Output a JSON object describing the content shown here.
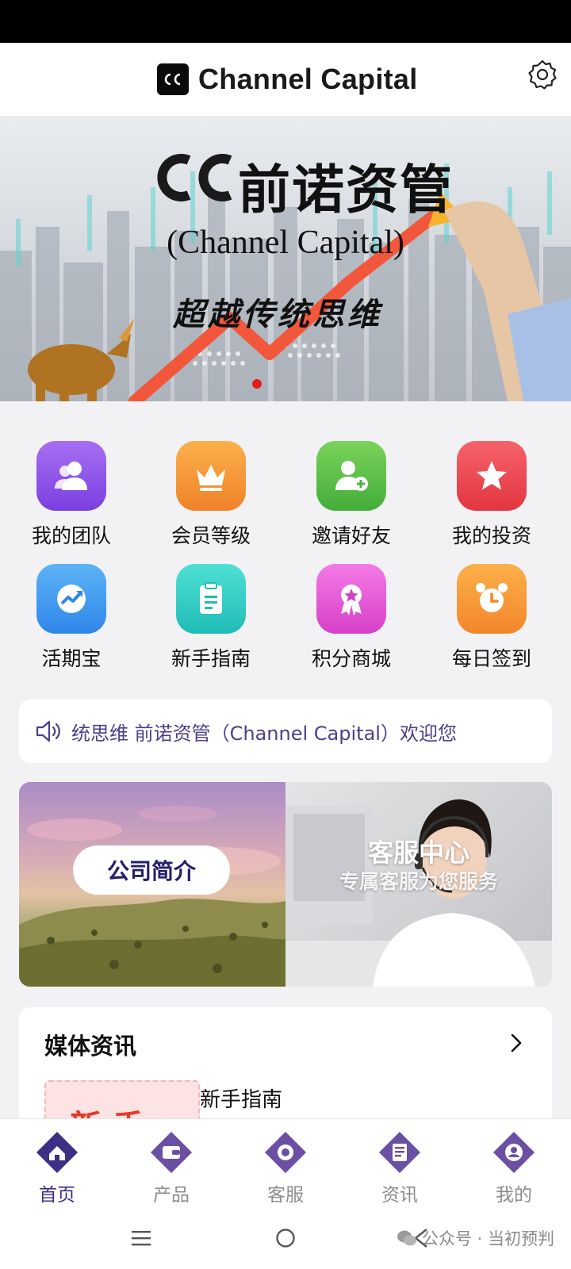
{
  "header": {
    "title": "Channel Capital",
    "logo_icon": "cc-logo-icon",
    "settings_icon": "gear-icon"
  },
  "banner": {
    "title_cn": "前诺资管",
    "title_en": "(Channel Capital)",
    "slogan": "超越传统思维",
    "active_slide": 1
  },
  "menu": [
    {
      "label": "我的团队",
      "icon": "team-icon",
      "color": "#8b4fe6"
    },
    {
      "label": "会员等级",
      "icon": "crown-icon",
      "color": "#f59433"
    },
    {
      "label": "邀请好友",
      "icon": "add-user-icon",
      "color": "#5cc44a"
    },
    {
      "label": "我的投资",
      "icon": "star-icon",
      "color": "#ef4a55"
    },
    {
      "label": "活期宝",
      "icon": "growth-icon",
      "color": "#3e9bf2"
    },
    {
      "label": "新手指南",
      "icon": "clipboard-icon",
      "color": "#2ecfc6"
    },
    {
      "label": "积分商城",
      "icon": "badge-icon",
      "color": "#e956d8"
    },
    {
      "label": "每日签到",
      "icon": "alarm-clock-icon",
      "color": "#f79a2e"
    }
  ],
  "notice": {
    "icon": "speaker-icon",
    "text": "统思维 前诺资管（Channel Capital）欢迎您"
  },
  "promos": {
    "about_label": "公司简介",
    "service_title": "客服中心",
    "service_subtitle": "专属客服为您服务"
  },
  "news": {
    "section_title": "媒体资讯",
    "more_icon": "chevron-right-icon",
    "items": [
      {
        "title": "新手指南",
        "thumb_text": "新手"
      }
    ]
  },
  "tabs": [
    {
      "label": "首页",
      "icon": "home-icon",
      "active": true
    },
    {
      "label": "产品",
      "icon": "wallet-icon",
      "active": false
    },
    {
      "label": "客服",
      "icon": "headset-icon",
      "active": false
    },
    {
      "label": "资讯",
      "icon": "news-icon",
      "active": false
    },
    {
      "label": "我的",
      "icon": "profile-icon",
      "active": false
    }
  ],
  "watermark": "公众号 · 当初预判",
  "colors": {
    "accent": "#3d2f86",
    "notice_text": "#4b3f8c",
    "banner_dot": "#e21d1d"
  }
}
